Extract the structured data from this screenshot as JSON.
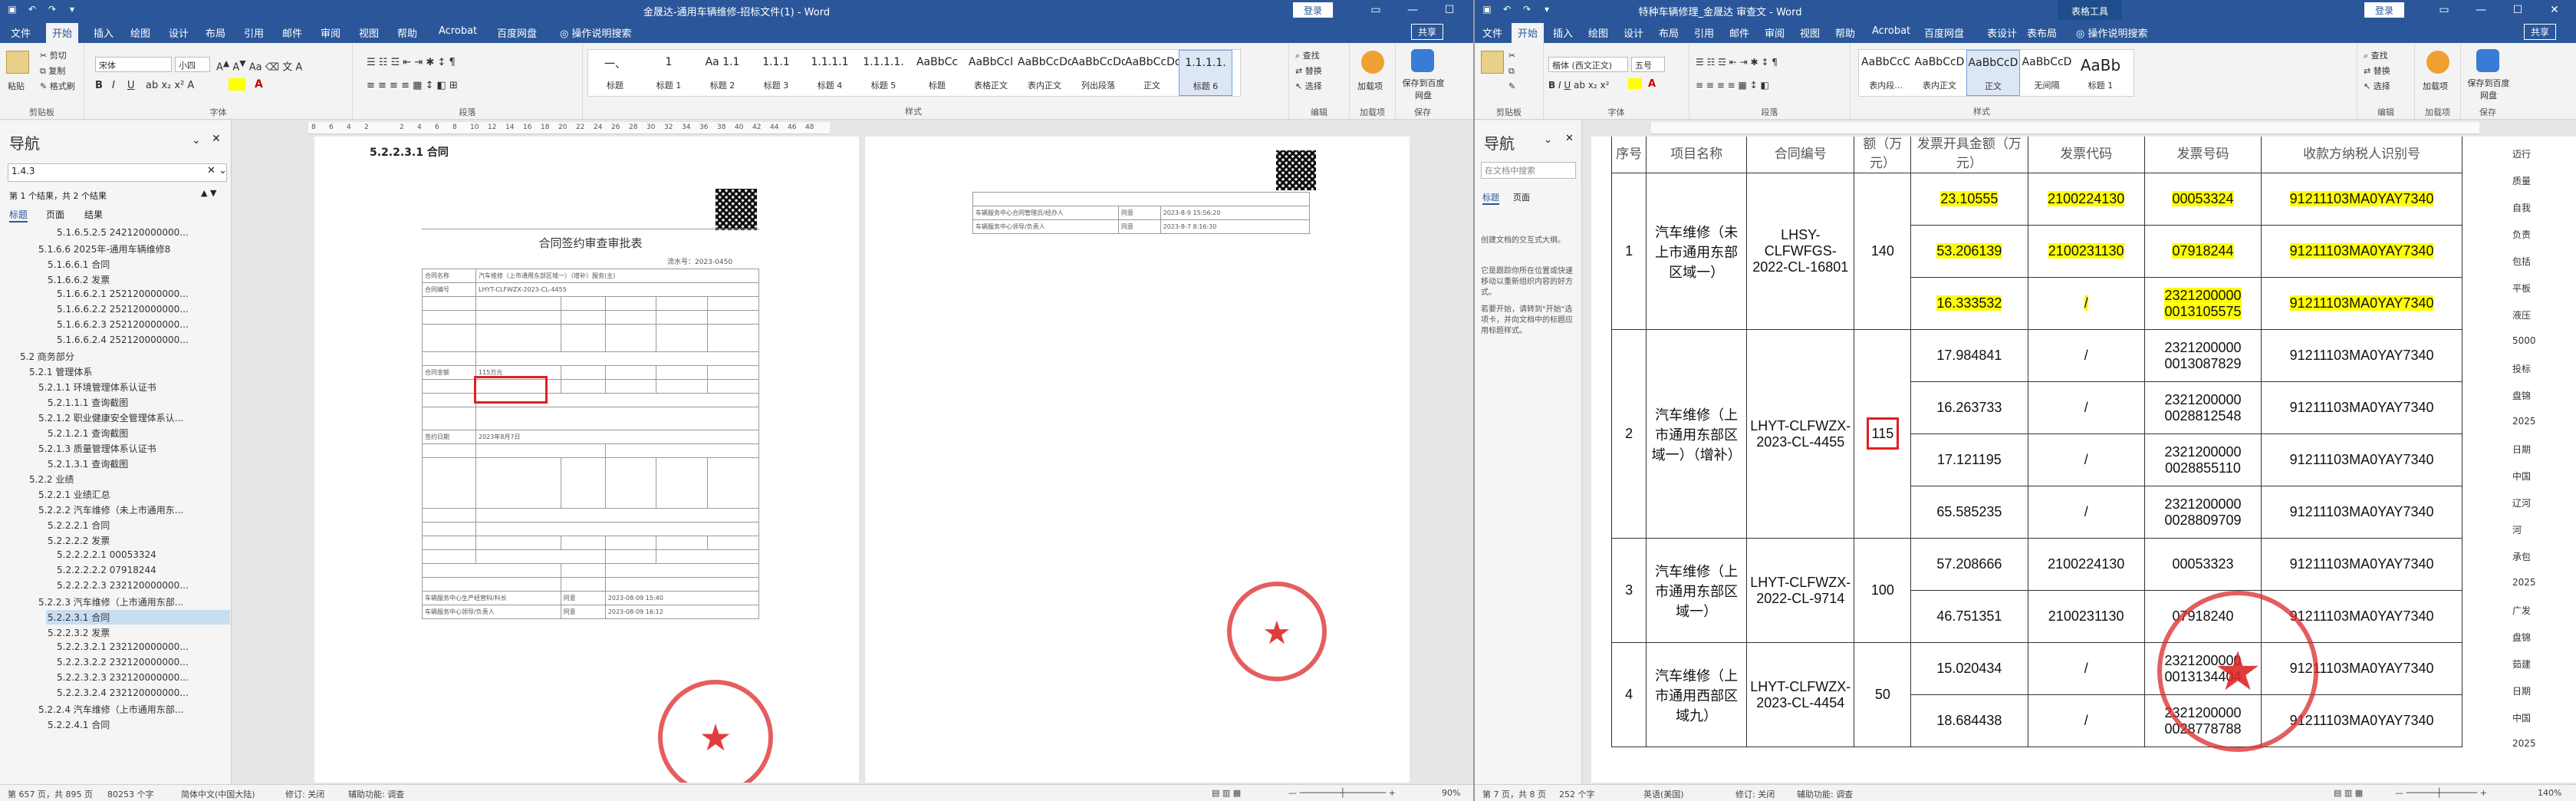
{
  "left": {
    "title": "金晟达-通用车辆维修-招标文件(1)  -  Word",
    "login": "登录",
    "share": "共享",
    "tabs": [
      "文件",
      "开始",
      "插入",
      "绘图",
      "设计",
      "布局",
      "引用",
      "邮件",
      "审阅",
      "视图",
      "帮助",
      "Acrobat",
      "百度网盘",
      "操作说明搜索"
    ],
    "clipboard": {
      "paste": "粘贴",
      "cut": "剪切",
      "copy": "复制",
      "painter": "格式刷",
      "label": "剪贴板"
    },
    "font": {
      "name": "宋体",
      "size": "小四",
      "label": "字体"
    },
    "paragraph_label": "段落",
    "styles_label": "样式",
    "styles": [
      {
        "preview": "一、",
        "name": "标题"
      },
      {
        "preview": "1",
        "name": "标题 1"
      },
      {
        "preview": "Aa 1.1",
        "name": "标题 2"
      },
      {
        "preview": "1.1.1",
        "name": "标题 3"
      },
      {
        "preview": "1.1.1.1",
        "name": "标题 4"
      },
      {
        "preview": "1.1.1.1.",
        "name": "标题 5"
      },
      {
        "preview": "AaBbCc",
        "name": "标题"
      },
      {
        "preview": "AaBbCcI",
        "name": "表格正文"
      },
      {
        "preview": "AaBbCcDd",
        "name": "表内正文"
      },
      {
        "preview": "AaBbCcDd",
        "name": "列出段落"
      },
      {
        "preview": "AaBbCcDd",
        "name": "正文"
      },
      {
        "preview": "1.1.1.1.",
        "name": "标题 6"
      }
    ],
    "editing": {
      "find": "查找",
      "replace": "替换",
      "select": "选择",
      "label": "编辑"
    },
    "addin": {
      "name": "加载项",
      "label": "加载项"
    },
    "save": {
      "name": "保存到百度网盘",
      "label": "保存"
    },
    "ruler": [
      "8",
      "6",
      "4",
      "2",
      "",
      "2",
      "4",
      "6",
      "8",
      "10",
      "12",
      "14",
      "16",
      "18",
      "20",
      "22",
      "24",
      "26",
      "28",
      "30",
      "32",
      "34",
      "36",
      "38",
      "40",
      "42",
      "44",
      "46",
      "48"
    ],
    "nav": {
      "title": "导航",
      "search": "1.4.3",
      "result": "第 1 个结果，共 2 个结果",
      "tabs": [
        "标题",
        "页面",
        "结果"
      ],
      "items": [
        "5.1.6.5.2.5 242120000000...",
        "5.1.6.6 2025年-通用车辆维修8",
        "5.1.6.6.1 合同",
        "5.1.6.6.2 发票",
        "5.1.6.6.2.1 252120000000...",
        "5.1.6.6.2.2 252120000000...",
        "5.1.6.6.2.3 252120000000...",
        "5.1.6.6.2.4 252120000000...",
        "5.2 商务部分",
        "5.2.1 管理体系",
        "5.2.1.1 环境管理体系认证书",
        "5.2.1.1.1 查询截图",
        "5.2.1.2 职业健康安全管理体系认...",
        "5.2.1.2.1 查询截图",
        "5.2.1.3 质量管理体系认证书",
        "5.2.1.3.1 查询截图",
        "5.2.2 业绩",
        "5.2.2.1 业绩汇总",
        "5.2.2.2 汽车维修（未上市通用东...",
        "5.2.2.2.1 合同",
        "5.2.2.2.2 发票",
        "5.2.2.2.2.1 00053324",
        "5.2.2.2.2.2 07918244",
        "5.2.2.2.2.3 232120000000...",
        "5.2.2.3 汽车维修（上市通用东部...",
        "5.2.2.3.1 合同",
        "5.2.2.3.2 发票",
        "5.2.2.3.2.1 232120000000...",
        "5.2.2.3.2.2 232120000000...",
        "5.2.2.3.2.3 232120000000...",
        "5.2.2.3.2.4 232120000000...",
        "5.2.2.4 汽车维修（上市通用东部...",
        "5.2.2.4.1 合同"
      ],
      "selected_index": 25
    },
    "page1": {
      "heading": "5.2.2.3.1 合同",
      "form_title": "合同签约审查审批表",
      "form_no": "流水号：2023-0450",
      "rows": [
        [
          "合同名称",
          "汽车维修（上市通用东部区域一）（增补）服务(主)"
        ],
        [
          "合同编号",
          "LHYT-CLFWZX-2023-CL-4455"
        ],
        [
          "合同金额",
          "115万元"
        ],
        [
          "签约日期",
          "2023年8月7日"
        ]
      ],
      "footer_rows": [
        [
          "车辆服务中心生产经营科/科长",
          "同意",
          "2023-08-09 15:40"
        ],
        [
          "车辆服务中心领导/负责人",
          "同意",
          "2023-08-09 16:12"
        ]
      ]
    },
    "page2": {
      "rows": [
        [
          "车辆服务中心合同管理员/经办人",
          "同意",
          "2023-8-9 15:56:20"
        ],
        [
          "车辆服务中心领导/负责人",
          "同意",
          "2023-8-7 8:16:30"
        ]
      ]
    },
    "status": {
      "page": "第 657 页，共 895 页",
      "words": "80253 个字",
      "lang": "简体中文(中国大陆)",
      "track": "修订: 关闭",
      "access": "辅助功能: 调查",
      "zoom": "90%"
    }
  },
  "right": {
    "title": "特种车辆修理_金晟达  审查文  -  Word",
    "context": "表格工具",
    "login": "登录",
    "share": "共享",
    "tabs": [
      "文件",
      "开始",
      "插入",
      "绘图",
      "设计",
      "布局",
      "引用",
      "邮件",
      "审阅",
      "视图",
      "帮助",
      "Acrobat",
      "百度网盘",
      "表设计",
      "表布局",
      "操作说明搜索"
    ],
    "font": {
      "name": "楷体 (西文正文)",
      "size": "五号"
    },
    "styles": [
      {
        "preview": "AaBbCcC",
        "name": "表内段..."
      },
      {
        "preview": "AaBbCcD",
        "name": "表内正文"
      },
      {
        "preview": "AaBbCcD",
        "name": "正文"
      },
      {
        "preview": "AaBbCcD",
        "name": "无间隔"
      },
      {
        "preview": "AaBb",
        "name": "标题 1"
      }
    ],
    "nav": {
      "title": "导航",
      "search_placeholder": "在文档中搜索",
      "tabs": [
        "标题",
        "页面"
      ],
      "help": [
        "创建文档的交互式大纲。",
        "它是跟踪你所在位置或快速移动以重新组织内容的好方式。",
        "若要开始，请转到\"开始\"选项卡，并向文档中的标题应用标题样式。"
      ]
    },
    "table": {
      "header": [
        "序号",
        "项目名称",
        "合同编号",
        "合同金额（万元）",
        "发票开具金额（万元）",
        "发票代码",
        "发票号码",
        "收款方纳税人识别号"
      ],
      "header_short": [
        "序号",
        "项目名称",
        "合同编号",
        "额（万元）",
        "发票开具金额（万元）",
        "发票代码",
        "发票号码",
        "收款方纳税人识别号"
      ],
      "groups": [
        {
          "no": "1",
          "project": "汽车维修（未上市通用东部区域一）",
          "contract": "LHSY-CLFWFGS-2022-CL-16801",
          "amount": "140",
          "invoices": [
            {
              "amt": "23.10555",
              "code": "2100224130",
              "num": "00053324",
              "tax": "91211103MA0YAY7340",
              "hl": true
            },
            {
              "amt": "53.206139",
              "code": "2100231130",
              "num": "07918244",
              "tax": "91211103MA0YAY7340",
              "hl": true
            },
            {
              "amt": "16.333532",
              "code": "/",
              "num": "2321200000\n0013105575",
              "tax": "91211103MA0YAY7340",
              "hl": true
            }
          ]
        },
        {
          "no": "2",
          "project": "汽车维修（上市通用东部区域一）（增补）",
          "contract": "LHYT-CLFWZX-2023-CL-4455",
          "amount": "115",
          "invoices": [
            {
              "amt": "17.984841",
              "code": "/",
              "num": "2321200000\n0013087829",
              "tax": "91211103MA0YAY7340",
              "hl": false
            },
            {
              "amt": "16.263733",
              "code": "/",
              "num": "2321200000\n0028812548",
              "tax": "91211103MA0YAY7340",
              "hl": false
            },
            {
              "amt": "17.121195",
              "code": "/",
              "num": "2321200000\n0028855110",
              "tax": "91211103MA0YAY7340",
              "hl": false
            },
            {
              "amt": "65.585235",
              "code": "/",
              "num": "2321200000\n0028809709",
              "tax": "91211103MA0YAY7340",
              "hl": false
            }
          ]
        },
        {
          "no": "3",
          "project": "汽车维修（上市通用东部区域一）",
          "contract": "LHYT-CLFWZX-2022-CL-9714",
          "amount": "100",
          "invoices": [
            {
              "amt": "57.208666",
              "code": "2100224130",
              "num": "00053323",
              "tax": "91211103MA0YAY7340",
              "hl": false
            },
            {
              "amt": "46.751351",
              "code": "2100231130",
              "num": "07918240",
              "tax": "91211103MA0YAY7340",
              "hl": false
            }
          ]
        },
        {
          "no": "4",
          "project": "汽车维修（上市通用西部区域九）",
          "contract": "LHYT-CLFWZX-2023-CL-4454",
          "amount": "50",
          "invoices": [
            {
              "amt": "15.020434",
              "code": "/",
              "num": "2321200000\n0013134404",
              "tax": "91211103MA0YAY7340",
              "hl": false
            },
            {
              "amt": "18.684438",
              "code": "/",
              "num": "2321200000\n0028778788",
              "tax": "91211103MA0YAY7340",
              "hl": false
            }
          ]
        }
      ]
    },
    "side_strip": [
      "迈行",
      "质量",
      "自我",
      "负责",
      "包括",
      "平板",
      "液压",
      "5000",
      "投标",
      "盘锦",
      "2025",
      "日期",
      "中国",
      "辽河",
      "河",
      "承包",
      "2025",
      "广发",
      "盘锦",
      "茹建",
      "日期",
      "中国",
      "2025"
    ],
    "status": {
      "page": "第 7 页，共 8 页",
      "words": "252 个字",
      "lang": "英语(美国)",
      "track": "修订: 关闭",
      "access": "辅助功能: 调查",
      "zoom": "140%"
    }
  }
}
